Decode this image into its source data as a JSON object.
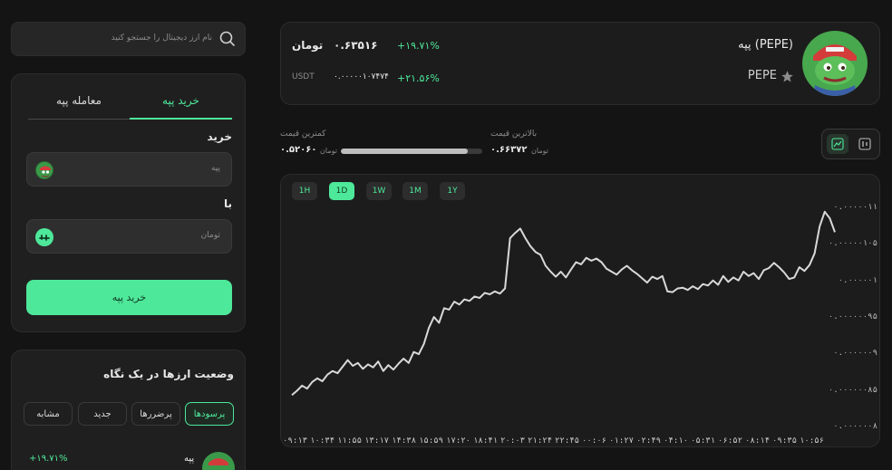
{
  "search": {
    "placeholder": "نام ارز دیجیتال را جستجو کنید"
  },
  "coin": {
    "title": "پپه (PEPE)",
    "symbol": "PEPE",
    "price_toman_unit": "تومان",
    "price_toman": "۰.۶۳۵۱۶",
    "change_toman": "+۱۹.۷۱%",
    "usdt_label": "USDT",
    "price_usdt": "۰.۰۰۰۰۰۱۰۷۴۷۴",
    "change_usdt": "+۲۱.۵۶%"
  },
  "range": {
    "high_label": "بالاترین قیمت",
    "high_value": "۰.۶۶۳۷۲",
    "high_unit": "تومان",
    "low_label": "کمترین قیمت",
    "low_value": "۰.۵۲۰۶۰",
    "low_unit": "تومان",
    "position": 0.9
  },
  "trade": {
    "tab_buy": "خرید پپه",
    "tab_trade": "معامله پپه",
    "buy_heading": "خرید",
    "buy_placeholder": "پپه",
    "with_label": "با",
    "pay_placeholder": "تومان",
    "submit": "خرید پپه"
  },
  "market": {
    "title": "وضعیت ارزها در یک نگاه",
    "tabs": [
      "پرسودها",
      "پرضررها",
      "جدید",
      "مشابه"
    ],
    "row_name": "پپه",
    "row_change": "+۱۹.۷۱%"
  },
  "chart_data": {
    "type": "line",
    "timeframes": [
      "1H",
      "1D",
      "1W",
      "1M",
      "1Y"
    ],
    "active_timeframe": "1D",
    "y_ticks": [
      "۰.۰۰۰۰۰۰۸",
      "۰.۰۰۰۰۰۰۸۵",
      "۰.۰۰۰۰۰۰۹",
      "۰.۰۰۰۰۰۰۹۵",
      "۰.۰۰۰۰۰۱",
      "۰.۰۰۰۰۰۱۰۵",
      "۰.۰۰۰۰۰۱۱"
    ],
    "ylim": [
      8e-07,
      1.1e-06
    ],
    "x_ticks": [
      "۰۹:۱۳",
      "۱۰:۳۴",
      "۱۱:۵۵",
      "۱۳:۱۷",
      "۱۴:۳۸",
      "۱۵:۵۹",
      "۱۷:۲۰",
      "۱۸:۴۱",
      "۲۰:۰۳",
      "۲۱:۲۴",
      "۲۲:۴۵",
      "۰۰:۰۶",
      "۰۱:۲۷",
      "۰۲:۴۹",
      "۰۴:۱۰",
      "۰۵:۳۱",
      "۰۶:۵۲",
      "۰۸:۱۴",
      "۰۹:۳۵",
      "۱۰:۵۶"
    ],
    "values": [
      8.43e-07,
      8.49e-07,
      8.56e-07,
      8.52e-07,
      8.61e-07,
      8.66e-07,
      8.62e-07,
      8.71e-07,
      8.76e-07,
      8.73e-07,
      8.82e-07,
      8.91e-07,
      8.83e-07,
      8.87e-07,
      8.79e-07,
      8.85e-07,
      8.81e-07,
      8.89e-07,
      8.76e-07,
      8.84e-07,
      8.78e-07,
      8.86e-07,
      8.93e-07,
      8.87e-07,
      9.02e-07,
      8.99e-07,
      9.13e-07,
      9.35e-07,
      9.5e-07,
      9.42e-07,
      9.62e-07,
      9.6e-07,
      9.71e-07,
      9.67e-07,
      9.74e-07,
      9.72e-07,
      9.78e-07,
      9.76e-07,
      9.83e-07,
      9.81e-07,
      9.85e-07,
      9.82e-07,
      9.89e-07,
      1.058e-06,
      1.065e-06,
      1.071e-06,
      1.058e-06,
      1.047e-06,
      1.039e-06,
      1.035e-06,
      1.02e-06,
      1.012e-06,
      1.005e-06,
      1.012e-06,
      1.004e-06,
      1.015e-06,
      1.025e-06,
      1.022e-06,
      1.031e-06,
      1.027e-06,
      1.03e-06,
      1.025e-06,
      1.016e-06,
      1.012e-06,
      1.008e-06,
      1.015e-06,
      1.02e-06,
      1.014e-06,
      1.009e-06,
      1.003e-06,
      9.97e-07,
      1.005e-06,
      1.002e-06,
      1.006e-06,
      9.85e-07,
      9.84e-07,
      9.89e-07,
      9.9e-07,
      9.87e-07,
      9.92e-07,
      9.88e-07,
      9.95e-07,
      9.93e-07,
      1e-06,
      9.94e-07,
      1.006e-06,
      9.98e-07,
      1.004e-06,
      1e-06,
      1.012e-06,
      1.006e-06,
      1.01e-06,
      1.002e-06,
      1.014e-06,
      1.017e-06,
      1.024e-06,
      1.018e-06,
      1.011e-06,
      1.002e-06,
      1.004e-06,
      1.018e-06,
      1.013e-06,
      1.021e-06,
      1.037e-06,
      1.074e-06,
      1.094e-06,
      1.085e-06,
      1.066e-06
    ]
  },
  "colors": {
    "accent": "#4ee89a",
    "bg": "#141414",
    "panel": "#1f1f1f",
    "line": "#d9d9d9"
  }
}
